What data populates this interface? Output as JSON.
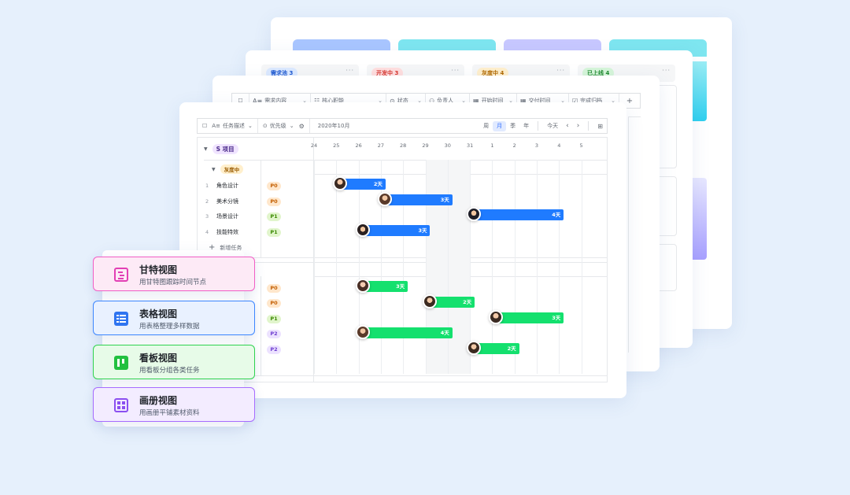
{
  "colors": {
    "page_bg": "#e6f0fc",
    "bar_blue": "#1f7bff",
    "bar_green": "#14e06e",
    "gantt_purple": "#f0e4ff",
    "gantt_blue": "#e6efff",
    "kanban_green": "#e9fbe9",
    "gallery_purple": "#f3ecff"
  },
  "gallery_view": {
    "header_bar_colors": [
      "#a9c6ff",
      "#7ee6f0",
      "#c8c8ff",
      "#7ee6f0"
    ]
  },
  "kanban_view": {
    "columns": [
      {
        "label": "需求池",
        "count": "3",
        "bg": "#dce9ff",
        "fg": "#1f5ad0"
      },
      {
        "label": "开发中",
        "count": "3",
        "bg": "#ffdede",
        "fg": "#d83931"
      },
      {
        "label": "灰度中",
        "count": "4",
        "bg": "#ffefcc",
        "fg": "#b26a00"
      },
      {
        "label": "已上线",
        "count": "4",
        "bg": "#d6f5d9",
        "fg": "#1f8a2e"
      }
    ],
    "more_label": "···"
  },
  "table_view": {
    "columns": [
      {
        "icon": "text-icon",
        "glyph": "A≡",
        "label": "需求内容"
      },
      {
        "icon": "list-icon",
        "glyph": "☷",
        "label": "核心职能"
      },
      {
        "icon": "status-icon",
        "glyph": "⊙",
        "label": "状态"
      },
      {
        "icon": "person-icon",
        "glyph": "⚇",
        "label": "负责人"
      },
      {
        "icon": "calendar-icon",
        "glyph": "▦",
        "label": "开始时间"
      },
      {
        "icon": "calendar-icon",
        "glyph": "▦",
        "label": "交付时间"
      },
      {
        "icon": "checkbox-icon",
        "glyph": "☑",
        "label": "完成归档"
      }
    ],
    "add_label": "+"
  },
  "gantt": {
    "toolbar": {
      "field_label": "任务描述",
      "priority_label": "优先级",
      "month_label": "2020年10月",
      "scales": [
        "周",
        "月",
        "季",
        "年"
      ],
      "active_scale": "月",
      "today_label": "今天",
      "prev_label": "‹",
      "next_label": "›"
    },
    "days": [
      "24",
      "25",
      "26",
      "27",
      "28",
      "29",
      "30",
      "31",
      "1",
      "2",
      "3",
      "4",
      "5"
    ],
    "weekend_indices": [
      5,
      6
    ],
    "group": {
      "label": "S 项目"
    },
    "subgroup": {
      "label": "灰度中"
    },
    "tasks": [
      {
        "num": "1",
        "name": "角色设计",
        "priority": "P0",
        "start": 1,
        "span": 2,
        "duration": "2天",
        "color": "#1f7bff",
        "avatar": "a1"
      },
      {
        "num": "2",
        "name": "美术分镜",
        "priority": "P0",
        "start": 3,
        "span": 3,
        "duration": "3天",
        "color": "#1f7bff",
        "avatar": "a2"
      },
      {
        "num": "3",
        "name": "场景设计",
        "priority": "P1",
        "start": 7,
        "span": 4,
        "duration": "4天",
        "color": "#1f7bff",
        "avatar": "a3"
      },
      {
        "num": "4",
        "name": "技能特效",
        "priority": "P1",
        "start": 2,
        "span": 3,
        "duration": "3天",
        "color": "#1f7bff",
        "avatar": "a4"
      }
    ],
    "add_task_label": "新增任务",
    "group2_tasks": [
      {
        "priority": "P0",
        "start": 2,
        "span": 2,
        "duration": "3天",
        "color": "#14e06e",
        "avatar": "a5"
      },
      {
        "priority": "P0",
        "start": 5,
        "span": 2,
        "duration": "2天",
        "color": "#14e06e",
        "avatar": "a6"
      },
      {
        "priority": "P1",
        "start": 8,
        "span": 3,
        "duration": "3天",
        "color": "#14e06e",
        "avatar": "a1"
      },
      {
        "priority": "P2",
        "start": 2,
        "span": 4,
        "duration": "4天",
        "color": "#14e06e",
        "avatar": "a2"
      },
      {
        "priority": "P2",
        "start": 7,
        "span": 2,
        "duration": "2天",
        "color": "#14e06e",
        "avatar": "a6"
      }
    ],
    "priority_colors": {
      "P0": {
        "bg": "#ffe7cc",
        "fg": "#c25e00"
      },
      "P1": {
        "bg": "#e1f5cc",
        "fg": "#3b8a00"
      },
      "P2": {
        "bg": "#ece2ff",
        "fg": "#6f3fd0"
      }
    }
  },
  "views": [
    {
      "title": "甘特视图",
      "subtitle": "用甘特图跟踪时间节点",
      "icon": "gantt-icon",
      "border": "#f25ec5",
      "bg": "#fdeaf6",
      "icon_color": "#e23fb4"
    },
    {
      "title": "表格视图",
      "subtitle": "用表格整理多样数据",
      "icon": "table-icon",
      "border": "#3c86ff",
      "bg": "#e9f1ff",
      "icon_color": "#2f74f0"
    },
    {
      "title": "看板视图",
      "subtitle": "用看板分组各类任务",
      "icon": "kanban-icon",
      "border": "#2fd24f",
      "bg": "#e7fbe8",
      "icon_color": "#21c03f"
    },
    {
      "title": "画册视图",
      "subtitle": "用画册平铺素材资料",
      "icon": "gallery-icon",
      "border": "#a66bff",
      "bg": "#f3ecff",
      "icon_color": "#8b4ff0"
    }
  ]
}
